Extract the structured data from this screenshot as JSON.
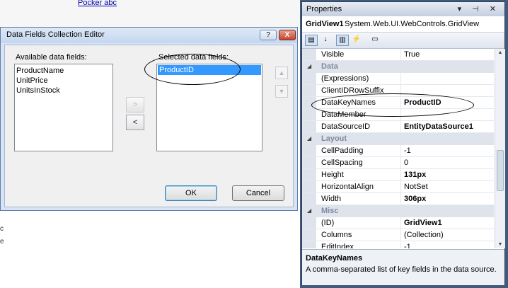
{
  "background": {
    "partial_text": "Pocker abc",
    "marks": [
      "c",
      "e"
    ]
  },
  "dialog": {
    "title": "Data Fields Collection Editor",
    "help_label": "?",
    "close_label": "X",
    "available_label": "Available data fields:",
    "available_fields": [
      "ProductName",
      "UnitPrice",
      "UnitsInStock"
    ],
    "selected_label": "Selected data fields:",
    "selected_fields": [
      "ProductID"
    ],
    "add_label": ">",
    "remove_label": "<",
    "ok_label": "OK",
    "cancel_label": "Cancel"
  },
  "properties": {
    "panel_title": "Properties",
    "title_icons": "▾ ⊣ ✕",
    "object_name": "GridView1",
    "object_type": "System.Web.UI.WebControls.GridView",
    "toolbar_icons": [
      "categorized-icon",
      "alphabetical-icon",
      "properties-icon",
      "events-icon",
      "property-pages-icon"
    ],
    "rows": [
      {
        "kind": "prop",
        "name": "Visible",
        "value": "True",
        "bold": false
      },
      {
        "kind": "cat",
        "name": "Data"
      },
      {
        "kind": "prop",
        "name": "(Expressions)",
        "value": "",
        "bold": false
      },
      {
        "kind": "prop",
        "name": "ClientIDRowSuffix",
        "value": "",
        "bold": false
      },
      {
        "kind": "prop",
        "name": "DataKeyNames",
        "value": "ProductID",
        "bold": true
      },
      {
        "kind": "prop",
        "name": "DataMember",
        "value": "",
        "bold": false
      },
      {
        "kind": "prop",
        "name": "DataSourceID",
        "value": "EntityDataSource1",
        "bold": true
      },
      {
        "kind": "cat",
        "name": "Layout"
      },
      {
        "kind": "prop",
        "name": "CellPadding",
        "value": "-1",
        "bold": false
      },
      {
        "kind": "prop",
        "name": "CellSpacing",
        "value": "0",
        "bold": false
      },
      {
        "kind": "prop",
        "name": "Height",
        "value": "131px",
        "bold": true
      },
      {
        "kind": "prop",
        "name": "HorizontalAlign",
        "value": "NotSet",
        "bold": false
      },
      {
        "kind": "prop",
        "name": "Width",
        "value": "306px",
        "bold": true
      },
      {
        "kind": "cat",
        "name": "Misc"
      },
      {
        "kind": "prop",
        "name": "(ID)",
        "value": "GridView1",
        "bold": true
      },
      {
        "kind": "prop",
        "name": "Columns",
        "value": "(Collection)",
        "bold": false
      },
      {
        "kind": "prop",
        "name": "EditIndex",
        "value": "-1",
        "bold": false
      }
    ],
    "description_title": "DataKeyNames",
    "description_text": "A comma-separated list of key fields in the data source."
  }
}
